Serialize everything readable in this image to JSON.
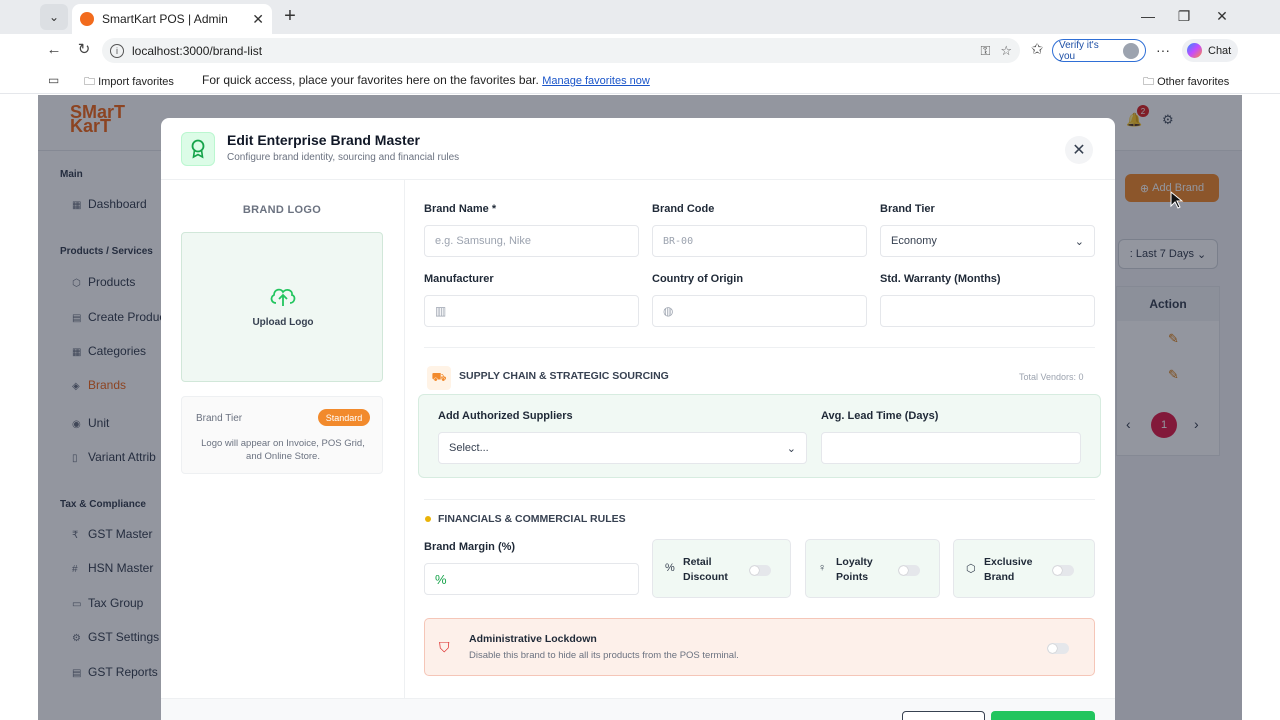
{
  "browser": {
    "tab_title": "SmartKart POS | Admin",
    "url": "localhost:3000/brand-list",
    "verify_label": "Verify it's you",
    "chat_label": "Chat",
    "fav_import": "Import favorites",
    "fav_hint": "For quick access, place your favorites here on the favorites bar.",
    "fav_manage": "Manage favorites now",
    "fav_other": "Other favorites"
  },
  "app": {
    "logo_top": "SMarT",
    "logo_bottom": "KarT",
    "notif_count": "2",
    "sidebar": {
      "main_header": "Main",
      "dashboard": "Dashboard",
      "products_header": "Products / Services",
      "items": [
        "Products",
        "Create Produc",
        "Categories",
        "Brands",
        "Unit",
        "Variant Attrib"
      ],
      "tax_header": "Tax & Compliance",
      "tax_items": [
        "GST Master",
        "HSN Master",
        "Tax Group",
        "GST Settings",
        "GST Reports"
      ]
    },
    "add_brand": "Add Brand",
    "filter": ": Last 7 Days",
    "table_action": "Action",
    "page": "1"
  },
  "modal": {
    "title": "Edit Enterprise Brand Master",
    "subtitle": "Configure brand identity, sourcing and financial rules",
    "logo_section": "BRAND LOGO",
    "upload_label": "Upload Logo",
    "tier_label": "Brand Tier",
    "tier_badge": "Standard",
    "tier_note": "Logo will appear on Invoice, POS Grid, and Online Store.",
    "brand_name_label": "Brand Name *",
    "brand_name_placeholder": "e.g. Samsung, Nike",
    "brand_code_label": "Brand Code",
    "brand_code_placeholder": "BR-00",
    "brand_tier_label": "Brand Tier",
    "brand_tier_value": "Economy",
    "manufacturer_label": "Manufacturer",
    "country_label": "Country of Origin",
    "warranty_label": "Std. Warranty (Months)",
    "supply_title": "SUPPLY CHAIN & STRATEGIC SOURCING",
    "total_vendors": "Total Vendors: 0",
    "suppliers_label": "Add Authorized Suppliers",
    "suppliers_value": "Select...",
    "lead_time_label": "Avg. Lead Time (Days)",
    "fin_title": "FINANCIALS & COMMERCIAL RULES",
    "margin_label": "Brand Margin (%)",
    "margin_prefix": "%",
    "toggles": [
      {
        "line1": "Retail",
        "line2": "Discount",
        "icon": "%"
      },
      {
        "line1": "Loyalty",
        "line2": "Points",
        "icon": "♀"
      },
      {
        "line1": "Exclusive",
        "line2": "Brand",
        "icon": "⬡"
      }
    ],
    "lockdown_title": "Administrative Lockdown",
    "lockdown_desc": "Disable this brand to hide all its products from the POS terminal."
  },
  "colors": {
    "accent": "#f28a2c",
    "success": "#22c55e",
    "danger": "#dc2626"
  }
}
